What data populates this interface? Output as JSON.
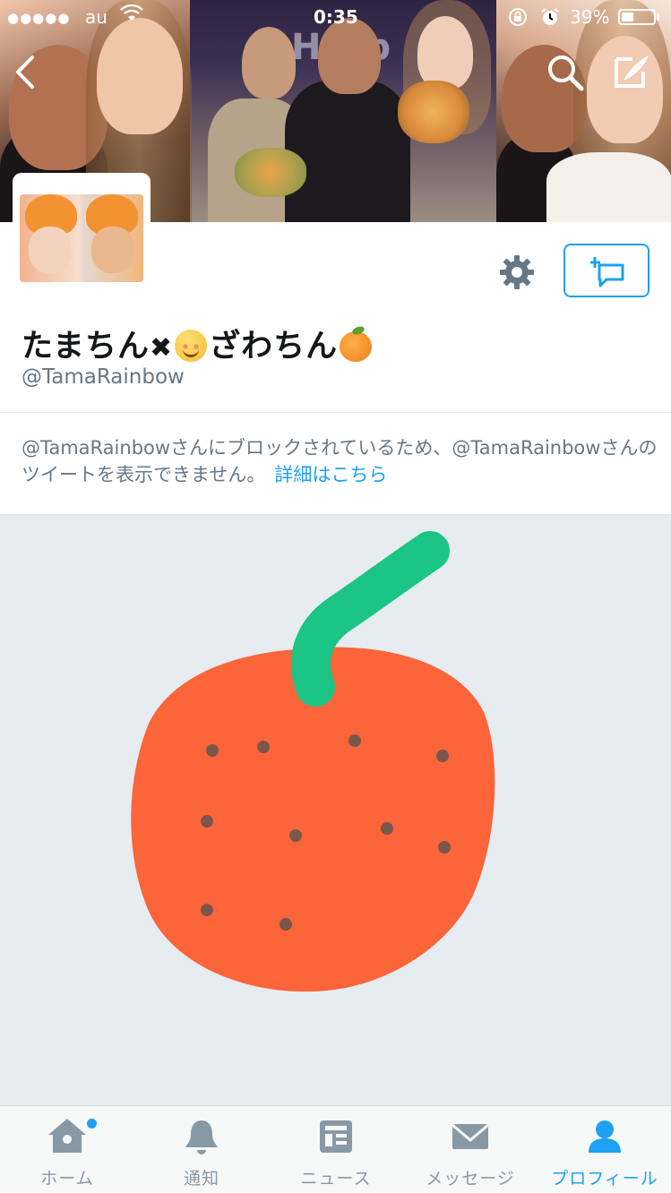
{
  "status_bar": {
    "signal_dots": "●●●●●",
    "carrier": "au",
    "time": "0:35",
    "battery_percent": "39%",
    "battery_level": 0.39
  },
  "header": {
    "icons": [
      "back-chevron-icon",
      "search-icon",
      "compose-tweet-icon"
    ],
    "banner_text": "Hoop"
  },
  "profile": {
    "name_part1": "たまちん",
    "name_cross": "✖",
    "name_part2": "ざわちん",
    "handle": "@TamaRainbow"
  },
  "notice": {
    "text": "@TamaRainbowさんにブロックされているため、@TamaRainbowさんのツイートを表示できません。",
    "link": "詳細はこちら"
  },
  "colors": {
    "accent": "#1da1f2",
    "tangerine": "#fc643a",
    "stem": "#1cc485",
    "dots": "#7b574b",
    "background_panel": "#e6ecf0"
  },
  "tabs": [
    {
      "label": "ホーム",
      "icon": "home-icon",
      "active": false
    },
    {
      "label": "通知",
      "icon": "bell-icon",
      "active": false
    },
    {
      "label": "ニュース",
      "icon": "news-icon",
      "active": false
    },
    {
      "label": "メッセージ",
      "icon": "envelope-icon",
      "active": false
    },
    {
      "label": "プロフィール",
      "icon": "person-icon",
      "active": true
    }
  ]
}
